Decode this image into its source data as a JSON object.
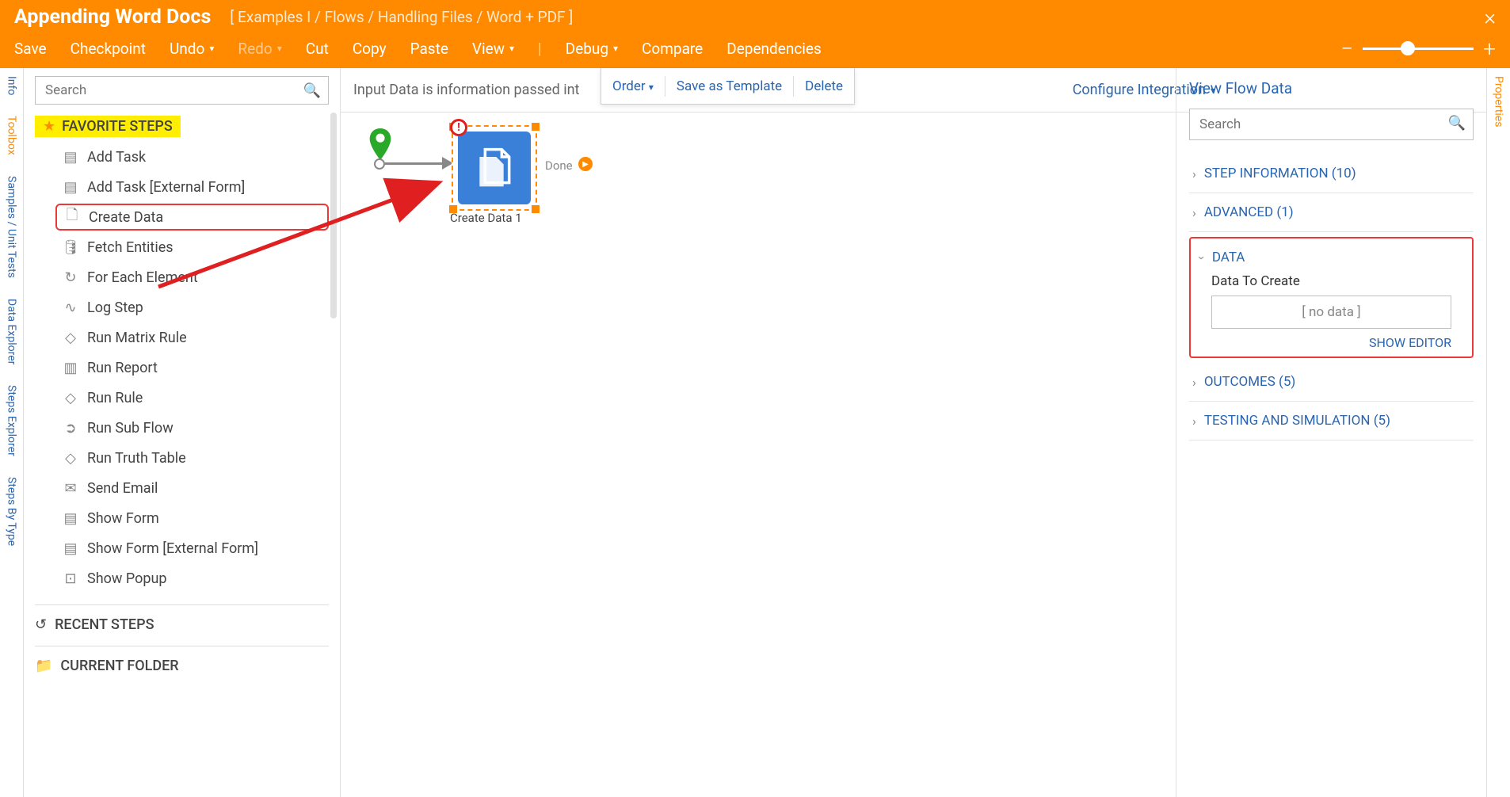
{
  "header": {
    "title": "Appending Word Docs",
    "breadcrumb": "[ Examples I / Flows / Handling Files / Word + PDF ]"
  },
  "menu": {
    "save": "Save",
    "checkpoint": "Checkpoint",
    "undo": "Undo",
    "redo": "Redo",
    "cut": "Cut",
    "copy": "Copy",
    "paste": "Paste",
    "view": "View",
    "debug": "Debug",
    "compare": "Compare",
    "dependencies": "Dependencies"
  },
  "left_rail": {
    "info": "Info",
    "toolbox": "Toolbox",
    "samples": "Samples / Unit Tests",
    "data_explorer": "Data Explorer",
    "steps_explorer": "Steps Explorer",
    "steps_by_type": "Steps By Type"
  },
  "right_rail": {
    "properties": "Properties"
  },
  "toolbox": {
    "search_placeholder": "Search",
    "favorite_heading": "FAVORITE STEPS",
    "steps": {
      "add_task": "Add Task",
      "add_task_ext": "Add Task [External Form]",
      "create_data": "Create Data",
      "fetch_entities": "Fetch Entities",
      "for_each": "For Each Element",
      "log_step": "Log Step",
      "run_matrix": "Run Matrix Rule",
      "run_report": "Run Report",
      "run_rule": "Run Rule",
      "run_sub_flow": "Run Sub Flow",
      "run_truth": "Run Truth Table",
      "send_email": "Send Email",
      "show_form": "Show Form",
      "show_form_ext": "Show Form [External Form]",
      "show_popup": "Show Popup"
    },
    "recent_heading": "RECENT STEPS",
    "current_folder_heading": "CURRENT FOLDER"
  },
  "canvas": {
    "topbar_text": "Input Data is information passed int",
    "dropdown": {
      "order": "Order",
      "save_template": "Save as Template",
      "delete": "Delete"
    },
    "configure": "Configure Integration",
    "node_label": "Create Data 1",
    "done_label": "Done"
  },
  "props": {
    "title": "View Flow Data",
    "search_placeholder": "Search",
    "step_info": "STEP INFORMATION (10)",
    "advanced": "ADVANCED (1)",
    "data": "DATA",
    "data_to_create": "Data To Create",
    "no_data": "[ no data ]",
    "show_editor": "SHOW EDITOR",
    "outcomes": "OUTCOMES (5)",
    "testing": "TESTING AND SIMULATION (5)"
  }
}
